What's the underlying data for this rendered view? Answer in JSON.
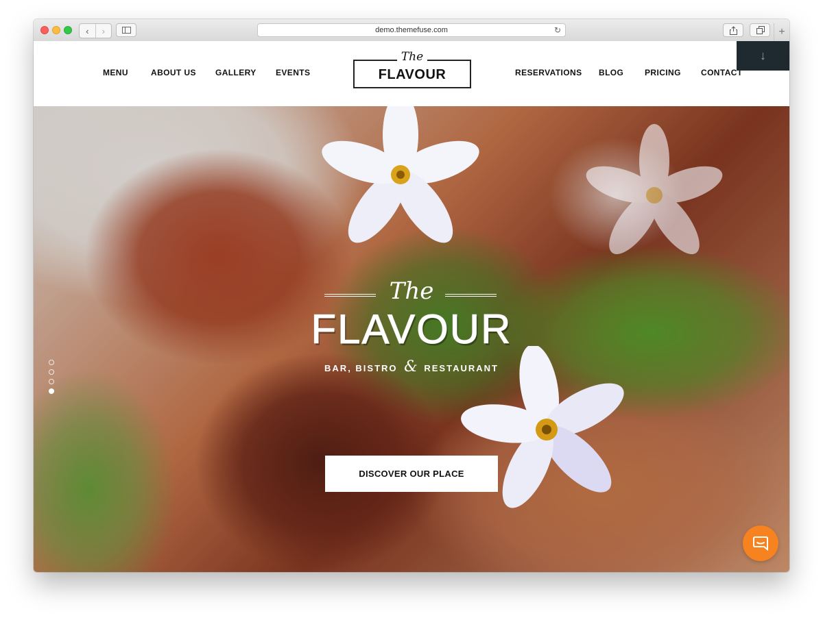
{
  "browser": {
    "url": "demo.themefuse.com"
  },
  "nav": {
    "left": [
      "MENU",
      "ABOUT US",
      "GALLERY",
      "EVENTS"
    ],
    "right": [
      "RESERVATIONS",
      "BLOG",
      "PRICING",
      "CONTACT"
    ]
  },
  "logo": {
    "script": "The",
    "name": "FLAVOUR"
  },
  "hero": {
    "script": "The",
    "title": "FLAVOUR",
    "subtitle_left": "BAR, BISTRO",
    "subtitle_amp": "&",
    "subtitle_right": "RESTAURANT",
    "cta_label": "DISCOVER OUR PLACE",
    "slides_total": 4,
    "active_slide": 4
  },
  "colors": {
    "accent": "#f6831f",
    "dark_panel": "#1f2a30"
  },
  "icons": {
    "download": "arrow-down-icon",
    "chat": "chat-bubble-icon"
  }
}
